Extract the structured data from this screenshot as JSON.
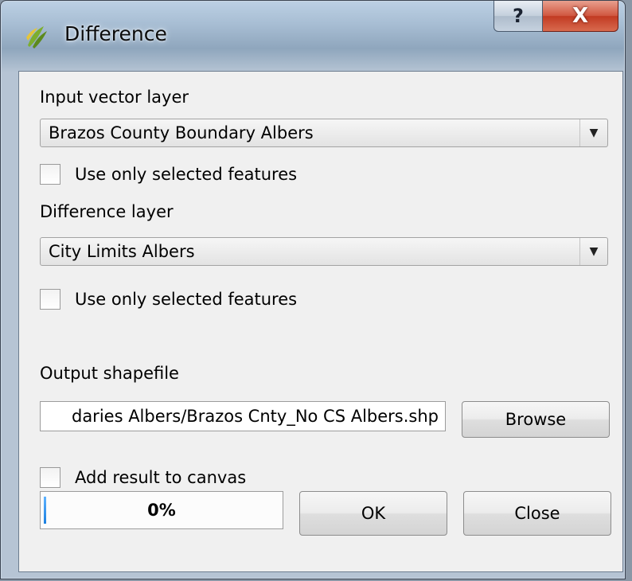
{
  "window": {
    "title": "Difference",
    "help_label": "?",
    "close_label": "X"
  },
  "input_vector": {
    "label": "Input vector layer",
    "selected_value": "Brazos County Boundary Albers",
    "use_selected_label": "Use only selected features",
    "use_selected_checked": false
  },
  "difference": {
    "label": "Difference layer",
    "selected_value": "City Limits Albers",
    "use_selected_label": "Use only selected features",
    "use_selected_checked": false
  },
  "output": {
    "label": "Output shapefile",
    "value": "daries Albers/Brazos Cnty_No CS Albers.shp",
    "browse_label": "Browse",
    "add_to_canvas_label": "Add result to canvas",
    "add_to_canvas_checked": false
  },
  "progress": {
    "value": 0,
    "text": "0%"
  },
  "footer": {
    "ok_label": "OK",
    "close_label": "Close"
  },
  "icons": {
    "app": "qgis-icon",
    "dropdown": "chevron-down-icon"
  }
}
